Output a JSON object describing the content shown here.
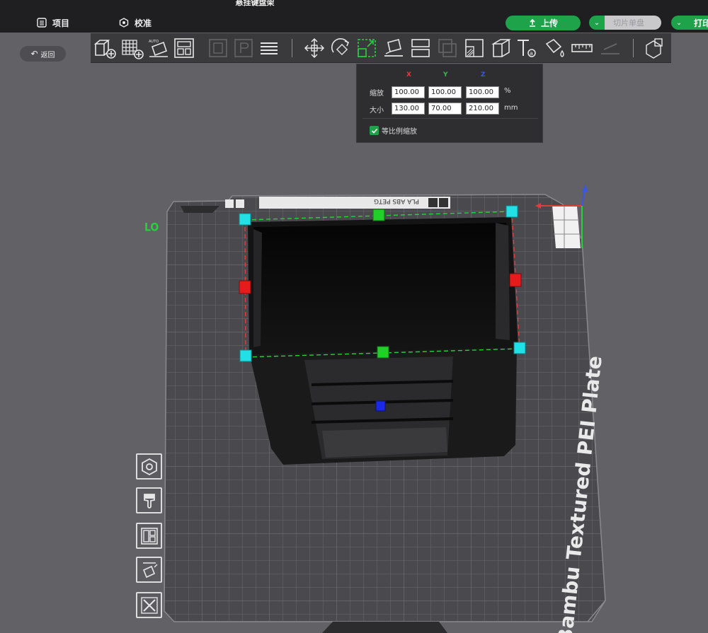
{
  "app": {
    "title": "悬挂键盘架"
  },
  "header": {
    "menu": [
      {
        "label": "项目",
        "icon": "project-list-icon"
      },
      {
        "label": "校准",
        "icon": "calibration-icon"
      }
    ],
    "upload_label": "上传",
    "slice_label": "切片单盘",
    "print_label": "打印"
  },
  "toolbar": {
    "tools": [
      "add-object-icon",
      "grid-add-icon",
      "auto-orient-icon",
      "arrange-icon",
      "layer-a-icon",
      "layer-b-icon",
      "layers-list-icon",
      "move-icon",
      "rotate-icon",
      "scale-icon",
      "lay-on-face-icon",
      "split-icon",
      "cut-icon",
      "support-paint-icon",
      "seam-paint-icon",
      "text-icon",
      "color-paint-icon",
      "measure-icon",
      "flatten-icon",
      "assembly-icon"
    ]
  },
  "back": {
    "label": "返回",
    "icon": "back-arrow-icon"
  },
  "scale_panel": {
    "axes": [
      "X",
      "Y",
      "Z"
    ],
    "scale_label": "缩放",
    "size_label": "大小",
    "scale_values": [
      "100.00",
      "100.00",
      "100.00"
    ],
    "size_values": [
      "130.00",
      "70.00",
      "210.00"
    ],
    "scale_unit": "%",
    "size_unit": "mm",
    "uniform_label": "等比例缩放",
    "uniform_checked": true,
    "colors": {
      "x": "#e33b3b",
      "y": "#2fc24a",
      "z": "#3a57e8"
    }
  },
  "plate": {
    "name": "Bambu Textured PEI Plate",
    "tag_text": "PLA ABS PETG",
    "marker_text": "LO"
  },
  "side_tools": [
    "settings-hex-icon",
    "bucket-icon",
    "layout-icon",
    "auto-orient-side-icon",
    "delete-icon"
  ],
  "accent": "#1fa34a"
}
